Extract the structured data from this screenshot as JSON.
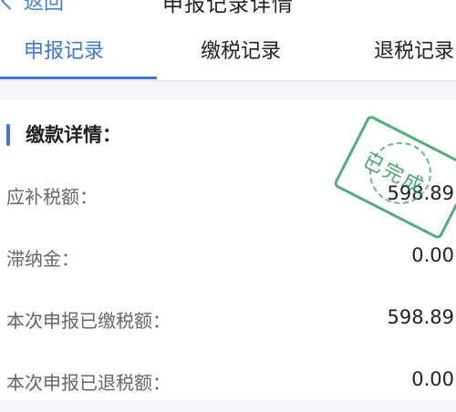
{
  "header": {
    "back_label": "返回",
    "title": "申报记录详情"
  },
  "tabs": [
    {
      "label": "申报记录",
      "active": true
    },
    {
      "label": "缴税记录",
      "active": false
    },
    {
      "label": "退税记录",
      "active": false
    }
  ],
  "section": {
    "title": "缴款详情："
  },
  "rows": [
    {
      "label": "应补税额：",
      "value": "598.89"
    },
    {
      "label": "滞纳金：",
      "value": "0.00"
    },
    {
      "label": "本次申报已缴税额：",
      "value": "598.89"
    },
    {
      "label": "本次申报已退税额：",
      "value": "0.00"
    }
  ],
  "stamp": {
    "text": "已完成",
    "color": "#34a062"
  },
  "colors": {
    "accent": "#3c78d8"
  }
}
